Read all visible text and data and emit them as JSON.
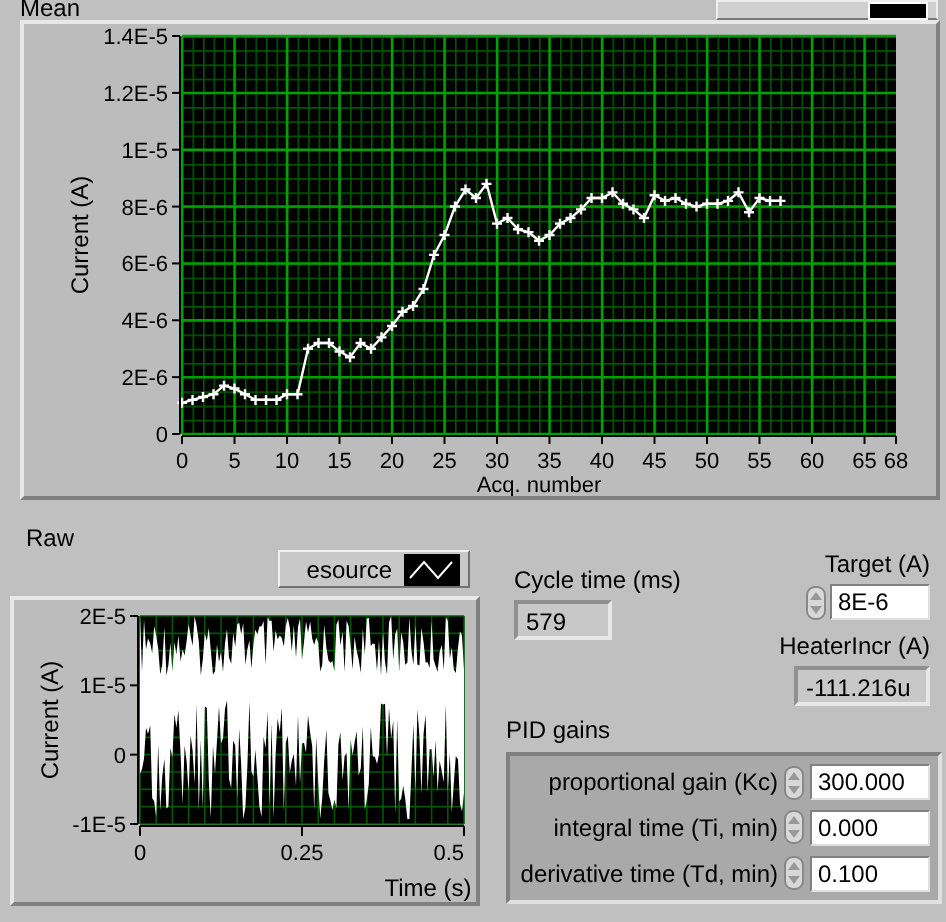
{
  "mean_panel": {
    "label": "Mean",
    "chart_data": {
      "type": "line",
      "xlabel": "Acq. number",
      "ylabel": "Current (A)",
      "x": [
        0,
        1,
        2,
        3,
        4,
        5,
        6,
        7,
        8,
        9,
        10,
        11,
        12,
        13,
        14,
        15,
        16,
        17,
        18,
        19,
        20,
        21,
        22,
        23,
        24,
        25,
        26,
        27,
        28,
        29,
        30,
        31,
        32,
        33,
        34,
        35,
        36,
        37,
        38,
        39,
        40,
        41,
        42,
        43,
        44,
        45,
        46,
        47,
        48,
        49,
        50,
        51,
        52,
        53,
        54,
        55,
        56,
        57
      ],
      "grid": true,
      "series": [
        {
          "color": "#ffffff",
          "marker": "+",
          "values": [
            1.1e-06,
            1.2e-06,
            1.3e-06,
            1.4e-06,
            1.7e-06,
            1.6e-06,
            1.4e-06,
            1.2e-06,
            1.2e-06,
            1.2e-06,
            1.4e-06,
            1.4e-06,
            3e-06,
            3.2e-06,
            3.2e-06,
            2.9e-06,
            2.7e-06,
            3.2e-06,
            3e-06,
            3.4e-06,
            3.8e-06,
            4.3e-06,
            4.5e-06,
            5.1e-06,
            6.3e-06,
            7e-06,
            8e-06,
            8.6e-06,
            8.3e-06,
            8.8e-06,
            7.4e-06,
            7.6e-06,
            7.2e-06,
            7.1e-06,
            6.8e-06,
            7e-06,
            7.4e-06,
            7.6e-06,
            7.9e-06,
            8.3e-06,
            8.3e-06,
            8.5e-06,
            8.1e-06,
            7.9e-06,
            7.6e-06,
            8.4e-06,
            8.2e-06,
            8.3e-06,
            8.1e-06,
            8e-06,
            8.1e-06,
            8.1e-06,
            8.2e-06,
            8.5e-06,
            7.8e-06,
            8.3e-06,
            8.2e-06,
            8.2e-06
          ]
        }
      ],
      "xlim": [
        0,
        68
      ],
      "ylim": [
        0,
        1.4e-05
      ],
      "xticks": [
        0,
        5,
        10,
        15,
        20,
        25,
        30,
        35,
        40,
        45,
        50,
        55,
        60,
        65,
        68
      ],
      "yticks": [
        {
          "value": 0,
          "label": "0"
        },
        {
          "value": 2e-06,
          "label": "2E-6"
        },
        {
          "value": 4e-06,
          "label": "4E-6"
        },
        {
          "value": 6e-06,
          "label": "6E-6"
        },
        {
          "value": 8e-06,
          "label": "8E-6"
        },
        {
          "value": 1e-05,
          "label": "1E-5"
        },
        {
          "value": 1.2e-05,
          "label": "1.2E-5"
        },
        {
          "value": 1.4e-05,
          "label": "1.4E-5"
        }
      ]
    }
  },
  "raw_panel": {
    "label": "Raw",
    "legend": {
      "label": "esource"
    },
    "ylabel": "Current (A)",
    "xlabel": "Time (s)",
    "y_tick_labels": [
      "2E-5",
      "1E-5",
      "0",
      "-1E-5"
    ],
    "x_tick_labels": [
      "0",
      "0.25",
      "0.5"
    ]
  },
  "cycle_time": {
    "label": "Cycle time (ms)",
    "value": "579"
  },
  "target": {
    "label": "Target (A)",
    "value": "8E-6"
  },
  "heater_incr": {
    "label": "HeaterIncr (A)",
    "value": "-111.216u"
  },
  "pid_gains": {
    "label": "PID gains",
    "rows": [
      {
        "label": "proportional gain (Kc)",
        "value": "300.000"
      },
      {
        "label": "integral time (Ti, min)",
        "value": "0.000"
      },
      {
        "label": "derivative time (Td, min)",
        "value": "0.100"
      }
    ]
  }
}
